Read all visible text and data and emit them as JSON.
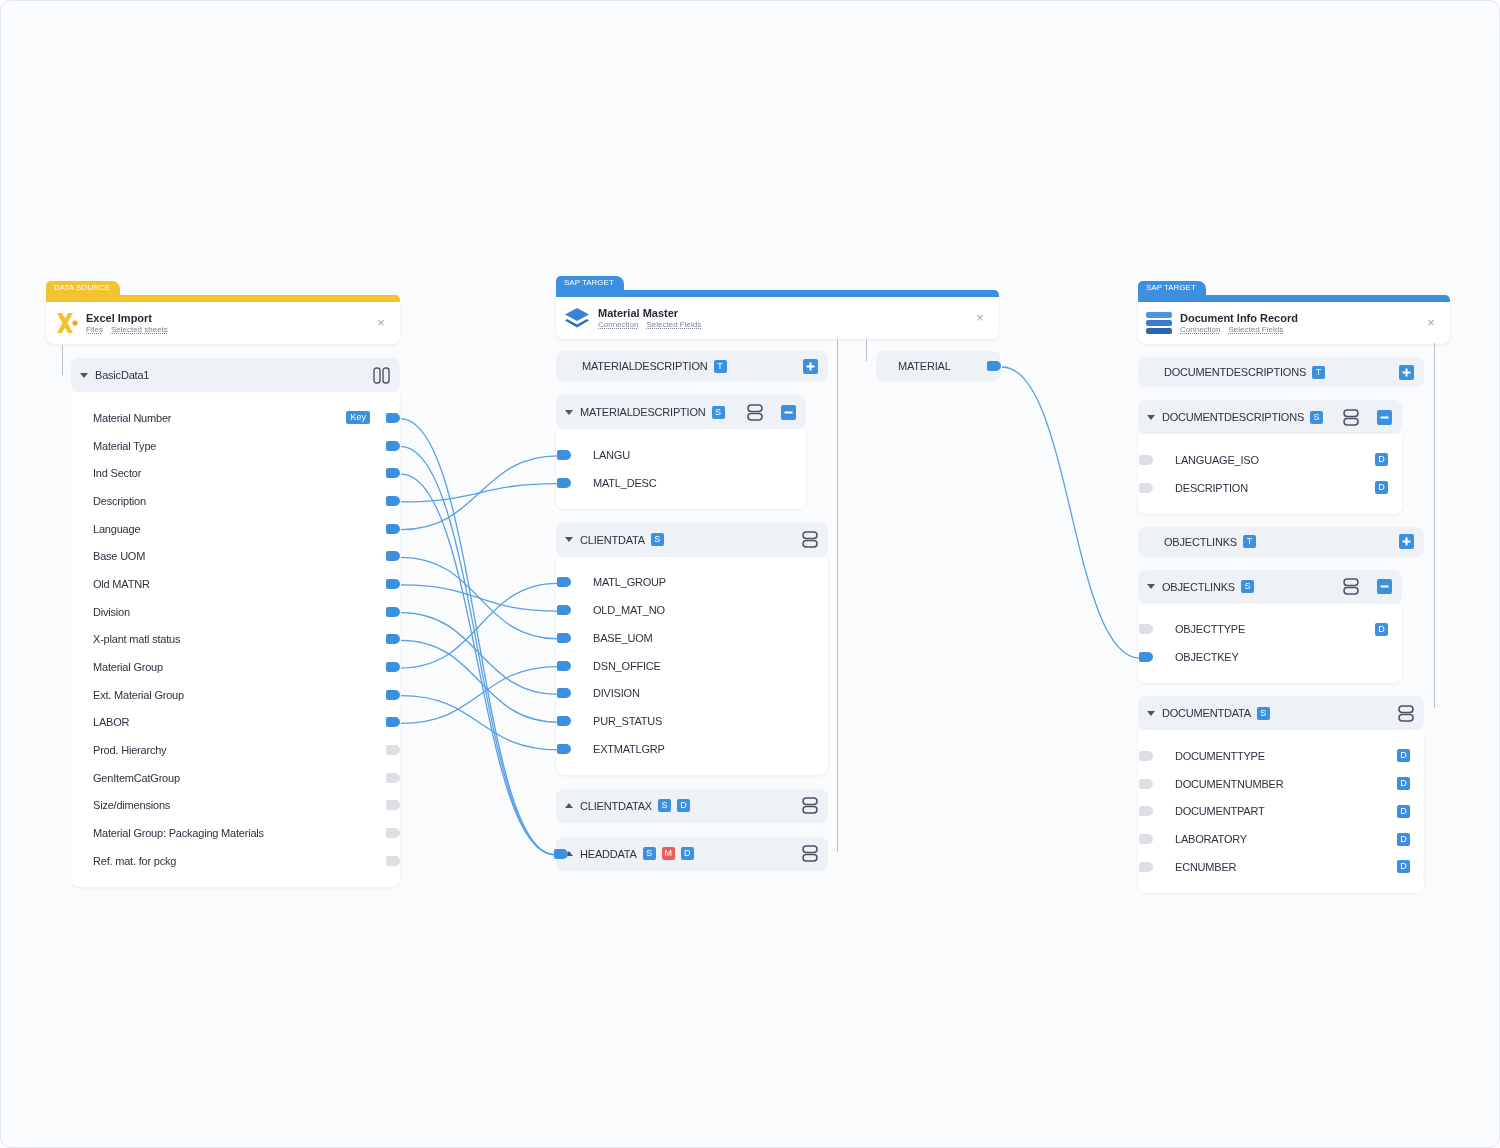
{
  "source": {
    "tab": "DATA SOURCE",
    "title": "Excel Import",
    "links": [
      "Files",
      "Selected sheets"
    ],
    "sheet": {
      "label": "BasicData1",
      "expanded": true
    },
    "fields": [
      {
        "name": "Material Number",
        "badges": [
          {
            "text": "Key",
            "color": "#3d8fe0"
          }
        ],
        "linked": true
      },
      {
        "name": "Material Type",
        "linked": true
      },
      {
        "name": "Ind Sector",
        "linked": true
      },
      {
        "name": "Description",
        "linked": true
      },
      {
        "name": "Language",
        "linked": true
      },
      {
        "name": "Base UOM",
        "linked": true
      },
      {
        "name": "Old MATNR",
        "linked": true
      },
      {
        "name": "Division",
        "linked": true
      },
      {
        "name": "X-plant matl status",
        "linked": true
      },
      {
        "name": "Material Group",
        "linked": true
      },
      {
        "name": "Ext. Material Group",
        "linked": true
      },
      {
        "name": "LABOR",
        "linked": true
      },
      {
        "name": "Prod. Hierarchy",
        "linked": false
      },
      {
        "name": "GenItemCatGroup",
        "linked": false
      },
      {
        "name": "Size/dimensions",
        "linked": false
      },
      {
        "name": "Material Group: Packaging Materials",
        "linked": false
      },
      {
        "name": "Ref. mat. for pckg",
        "linked": false
      }
    ]
  },
  "material_master": {
    "tab": "SAP TARGET",
    "title": "Material Master",
    "links": [
      "Connection",
      "Selected Fields"
    ],
    "key_field": {
      "label": "MATERIAL",
      "linked": true
    },
    "segments": [
      {
        "kind": "table",
        "label": "MATERIALDESCRIPTION",
        "badges": [
          {
            "text": "T",
            "color": "#3d8fe0"
          }
        ]
      },
      {
        "kind": "structure",
        "label": "MATERIALDESCRIPTION",
        "expanded": true,
        "removable": true,
        "linked": false,
        "badges": [
          {
            "text": "S",
            "color": "#3d8fe0"
          }
        ],
        "fields": [
          {
            "name": "LANGU",
            "linked": true
          },
          {
            "name": "MATL_DESC",
            "linked": true
          }
        ]
      },
      {
        "kind": "structure",
        "label": "CLIENTDATA",
        "expanded": true,
        "removable": false,
        "linked": false,
        "badges": [
          {
            "text": "S",
            "color": "#3d8fe0"
          }
        ],
        "fields": [
          {
            "name": "MATL_GROUP",
            "linked": true
          },
          {
            "name": "OLD_MAT_NO",
            "linked": true
          },
          {
            "name": "BASE_UOM",
            "linked": true
          },
          {
            "name": "DSN_OFFICE",
            "linked": true
          },
          {
            "name": "DIVISION",
            "linked": true
          },
          {
            "name": "PUR_STATUS",
            "linked": true
          },
          {
            "name": "EXTMATLGRP",
            "linked": true
          }
        ]
      },
      {
        "kind": "structure",
        "label": "CLIENTDATAX",
        "expanded": false,
        "removable": false,
        "linked": false,
        "badges": [
          {
            "text": "S",
            "color": "#3d8fe0"
          },
          {
            "text": "D",
            "color": "#3d8fe0"
          }
        ]
      },
      {
        "kind": "structure",
        "label": "HEADDATA",
        "expanded": false,
        "removable": false,
        "linked": true,
        "badges": [
          {
            "text": "S",
            "color": "#3d8fe0"
          },
          {
            "text": "M",
            "color": "#ee5b5b"
          },
          {
            "text": "D",
            "color": "#3d8fe0"
          }
        ]
      }
    ]
  },
  "document_info": {
    "tab": "SAP TARGET",
    "title": "Document Info Record",
    "links": [
      "Connection",
      "Selected Fields"
    ],
    "segments": [
      {
        "kind": "table",
        "label": "DOCUMENTDESCRIPTIONS",
        "badges": [
          {
            "text": "T",
            "color": "#3d8fe0"
          }
        ]
      },
      {
        "kind": "structure",
        "label": "DOCUMENTDESCRIPTIONS",
        "expanded": true,
        "removable": true,
        "linked": false,
        "badges": [
          {
            "text": "S",
            "color": "#3d8fe0"
          }
        ],
        "fields": [
          {
            "name": "LANGUAGE_ISO",
            "linked": false,
            "badges": [
              {
                "text": "D",
                "color": "#3d8fe0"
              }
            ]
          },
          {
            "name": "DESCRIPTION",
            "linked": false,
            "badges": [
              {
                "text": "D",
                "color": "#3d8fe0"
              }
            ]
          }
        ]
      },
      {
        "kind": "table",
        "label": "OBJECTLINKS",
        "badges": [
          {
            "text": "T",
            "color": "#3d8fe0"
          }
        ]
      },
      {
        "kind": "structure",
        "label": "OBJECTLINKS",
        "expanded": true,
        "removable": true,
        "linked": false,
        "badges": [
          {
            "text": "S",
            "color": "#3d8fe0"
          }
        ],
        "fields": [
          {
            "name": "OBJECTTYPE",
            "linked": false,
            "badges": [
              {
                "text": "D",
                "color": "#3d8fe0"
              }
            ]
          },
          {
            "name": "OBJECTKEY",
            "linked": true
          }
        ]
      },
      {
        "kind": "structure",
        "label": "DOCUMENTDATA",
        "expanded": true,
        "removable": false,
        "linked": false,
        "badges": [
          {
            "text": "S",
            "color": "#3d8fe0"
          }
        ],
        "fields": [
          {
            "name": "DOCUMENTTYPE",
            "linked": false,
            "badges": [
              {
                "text": "D",
                "color": "#3d8fe0"
              }
            ]
          },
          {
            "name": "DOCUMENTNUMBER",
            "linked": false,
            "badges": [
              {
                "text": "D",
                "color": "#3d8fe0"
              }
            ]
          },
          {
            "name": "DOCUMENTPART",
            "linked": false,
            "badges": [
              {
                "text": "D",
                "color": "#3d8fe0"
              }
            ]
          },
          {
            "name": "LABORATORY",
            "linked": false,
            "badges": [
              {
                "text": "D",
                "color": "#3d8fe0"
              }
            ]
          },
          {
            "name": "ECNUMBER",
            "linked": false,
            "badges": [
              {
                "text": "D",
                "color": "#3d8fe0"
              }
            ]
          }
        ]
      }
    ]
  },
  "close_buttons": [
    "×",
    "×",
    "×"
  ]
}
